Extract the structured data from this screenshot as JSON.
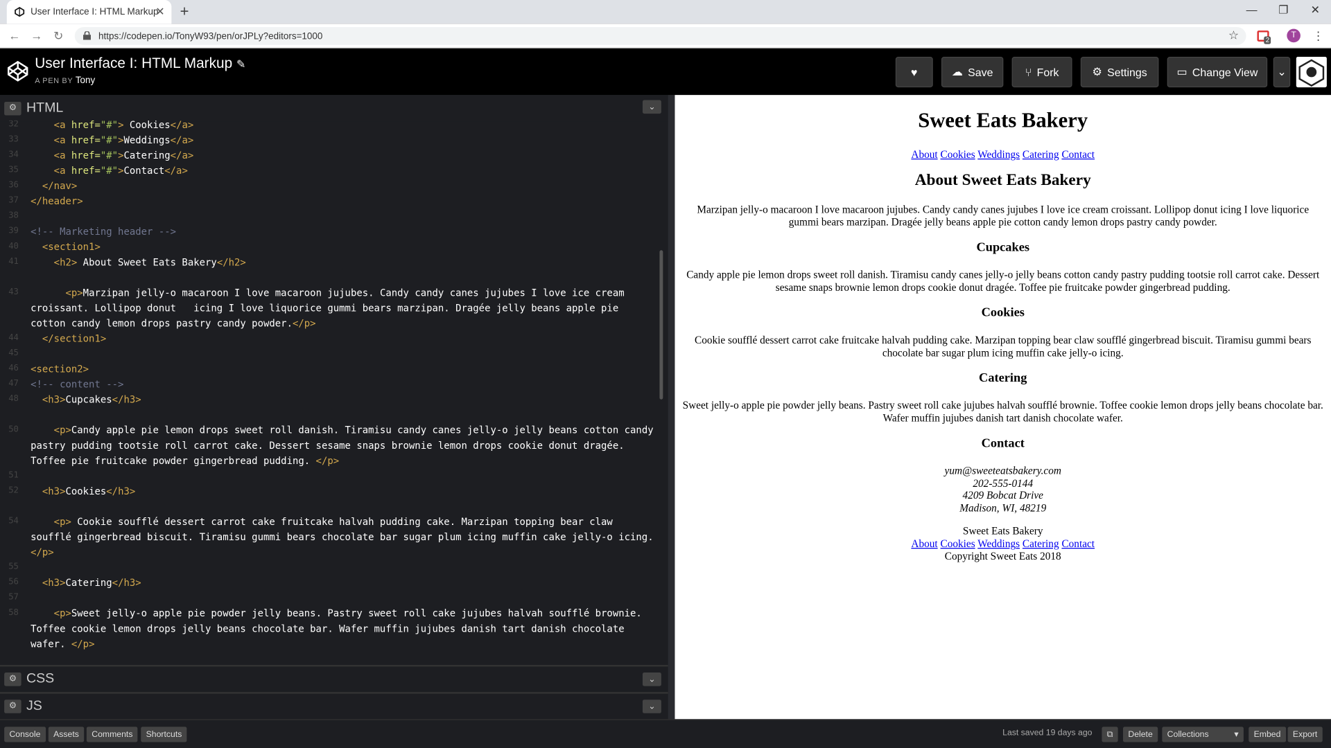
{
  "browser": {
    "tab_title": "User Interface I: HTML Markup",
    "url": "https://codepen.io/TonyW93/pen/orJPLy?editors=1000",
    "profile_initial": "T",
    "ext_badge": "2"
  },
  "pen": {
    "title": "User Interface I: HTML Markup",
    "by_label": "A PEN BY",
    "author": "Tony"
  },
  "toolbar": {
    "save": "Save",
    "fork": "Fork",
    "settings": "Settings",
    "change_view": "Change View"
  },
  "editors": {
    "html": "HTML",
    "css": "CSS",
    "js": "JS"
  },
  "code_lines": [
    {
      "n": "32",
      "html": "    <span class='t'>&lt;a</span> <span class='a'>href=</span><span class='s'>\"#\"</span><span class='t'>&gt;</span> Cookies<span class='t'>&lt;/a&gt;</span>"
    },
    {
      "n": "33",
      "html": "    <span class='t'>&lt;a</span> <span class='a'>href=</span><span class='s'>\"#\"</span><span class='t'>&gt;</span>Weddings<span class='t'>&lt;/a&gt;</span>"
    },
    {
      "n": "34",
      "html": "    <span class='t'>&lt;a</span> <span class='a'>href=</span><span class='s'>\"#\"</span><span class='t'>&gt;</span>Catering<span class='t'>&lt;/a&gt;</span>"
    },
    {
      "n": "35",
      "html": "    <span class='t'>&lt;a</span> <span class='a'>href=</span><span class='s'>\"#\"</span><span class='t'>&gt;</span>Contact<span class='t'>&lt;/a&gt;</span>"
    },
    {
      "n": "36",
      "html": "  <span class='t'>&lt;/nav&gt;</span>"
    },
    {
      "n": "37",
      "html": "<span class='t'>&lt;/header&gt;</span>"
    },
    {
      "n": "38",
      "html": ""
    },
    {
      "n": "39",
      "html": "<span class='c'>&lt;!-- Marketing header --&gt;</span>"
    },
    {
      "n": "40",
      "html": "  <span class='t'>&lt;section1&gt;</span>"
    },
    {
      "n": "41",
      "html": "    <span class='t'>&lt;h2&gt;</span> About Sweet Eats Bakery<span class='t'>&lt;/h2&gt;</span>"
    },
    {
      "n": "",
      "html": ""
    },
    {
      "n": "43",
      "html": "      <span class='t'>&lt;p&gt;</span>Marzipan jelly-o macaroon I love macaroon jujubes. Candy candy canes jujubes I love ice cream croissant. Lollipop donut   icing I love liquorice gummi bears marzipan. Dragée jelly beans apple pie cotton candy lemon drops pastry candy powder.<span class='t'>&lt;/p&gt;</span>",
      "rows": 3
    },
    {
      "n": "44",
      "html": "  <span class='t'>&lt;/section1&gt;</span>"
    },
    {
      "n": "45",
      "html": ""
    },
    {
      "n": "46",
      "html": "<span class='t'>&lt;section2&gt;</span>"
    },
    {
      "n": "47",
      "html": "<span class='c'>&lt;!-- content --&gt;</span>"
    },
    {
      "n": "48",
      "html": "  <span class='t'>&lt;h3&gt;</span>Cupcakes<span class='t'>&lt;/h3&gt;</span>"
    },
    {
      "n": "",
      "html": ""
    },
    {
      "n": "50",
      "html": "    <span class='t'>&lt;p&gt;</span>Candy apple pie lemon drops sweet roll danish. Tiramisu candy canes jelly-o jelly beans cotton candy pastry pudding tootsie roll carrot cake. Dessert sesame snaps brownie lemon drops cookie donut dragée. Toffee pie fruitcake powder gingerbread pudding. <span class='t'>&lt;/p&gt;</span>",
      "rows": 3
    },
    {
      "n": "51",
      "html": ""
    },
    {
      "n": "52",
      "html": "  <span class='t'>&lt;h3&gt;</span>Cookies<span class='t'>&lt;/h3&gt;</span>"
    },
    {
      "n": "",
      "html": ""
    },
    {
      "n": "54",
      "html": "    <span class='t'>&lt;p&gt;</span> Cookie soufflé dessert carrot cake fruitcake halvah pudding cake. Marzipan topping bear claw soufflé gingerbread biscuit. Tiramisu gummi bears chocolate bar sugar plum icing muffin cake jelly-o icing. <span class='t'>&lt;/p&gt;</span>",
      "rows": 3
    },
    {
      "n": "55",
      "html": ""
    },
    {
      "n": "56",
      "html": "  <span class='t'>&lt;h3&gt;</span>Catering<span class='t'>&lt;/h3&gt;</span>"
    },
    {
      "n": "57",
      "html": ""
    },
    {
      "n": "58",
      "html": "    <span class='t'>&lt;p&gt;</span>Sweet jelly-o apple pie powder jelly beans. Pastry sweet roll cake jujubes halvah soufflé brownie. Toffee cookie lemon drops jelly beans chocolate bar. Wafer muffin jujubes danish tart danish chocolate wafer. <span class='t'>&lt;/p&gt;</span>",
      "rows": 3
    }
  ],
  "preview": {
    "title": "Sweet Eats Bakery",
    "nav": [
      "About",
      "Cookies",
      "Weddings",
      "Catering",
      "Contact"
    ],
    "about_heading": "About Sweet Eats Bakery",
    "about_text": "Marzipan jelly-o macaroon I love macaroon jujubes. Candy candy canes jujubes I love ice cream croissant. Lollipop donut icing I love liquorice gummi bears marzipan. Dragée jelly beans apple pie cotton candy lemon drops pastry candy powder.",
    "sections": [
      {
        "heading": "Cupcakes",
        "text": "Candy apple pie lemon drops sweet roll danish. Tiramisu candy canes jelly-o jelly beans cotton candy pastry pudding tootsie roll carrot cake. Dessert sesame snaps brownie lemon drops cookie donut dragée. Toffee pie fruitcake powder gingerbread pudding."
      },
      {
        "heading": "Cookies",
        "text": "Cookie soufflé dessert carrot cake fruitcake halvah pudding cake. Marzipan topping bear claw soufflé gingerbread biscuit. Tiramisu gummi bears chocolate bar sugar plum icing muffin cake jelly-o icing."
      },
      {
        "heading": "Catering",
        "text": "Sweet jelly-o apple pie powder jelly beans. Pastry sweet roll cake jujubes halvah soufflé brownie. Toffee cookie lemon drops jelly beans chocolate bar. Wafer muffin jujubes danish tart danish chocolate wafer."
      }
    ],
    "contact_heading": "Contact",
    "contact": {
      "email": "yum@sweeteatsbakery.com",
      "phone": "202-555-0144",
      "street": "4209 Bobcat Drive",
      "city": "Madison, WI, 48219"
    },
    "footer_name": "Sweet Eats Bakery",
    "copyright": "Copyright Sweet Eats 2018"
  },
  "footer": {
    "console": "Console",
    "assets": "Assets",
    "comments": "Comments",
    "shortcuts": "Shortcuts",
    "last_saved": "Last saved 19 days ago",
    "delete": "Delete",
    "collections": "Collections",
    "embed": "Embed",
    "export": "Export"
  }
}
